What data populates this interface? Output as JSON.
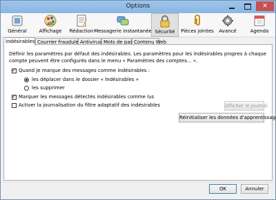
{
  "window": {
    "title": "Options"
  },
  "toolbar": {
    "items": [
      {
        "label": "Général",
        "icon": "general-switch-icon"
      },
      {
        "label": "Affichage",
        "icon": "display-palette-icon"
      },
      {
        "label": "Rédaction",
        "icon": "composition-icon"
      },
      {
        "label": "Messagerie instantanée",
        "icon": "chat-bubbles-icon"
      },
      {
        "label": "Sécurité",
        "icon": "lock-icon"
      },
      {
        "label": "Pièces jointes",
        "icon": "paperclip-icon"
      },
      {
        "label": "Avancé",
        "icon": "gear-icon"
      },
      {
        "label": "Agenda",
        "icon": "calendar-icon"
      }
    ],
    "active": "Sécurité"
  },
  "tabs": [
    "Indésirables",
    "Courrier frauduleux",
    "Antivirus",
    "Mots de passe",
    "Contenu Web"
  ],
  "content": {
    "description": "Définir les paramètres par défaut des indésirables. Les paramètres pour les indésirables propres à chaque compte peuvent être configurés dans le menu « Paramètres des comptes... ».",
    "when_marked": "Quand je marque des messages comme indésirables :",
    "move_option": "les déplacer dans le dossier « Indésirables »",
    "delete_option": "les supprimer",
    "mark_read": "Marquer les messages détectés indésirables comme lus",
    "enable_log": "Activer la journalisation du filtre adaptatif des indésirables",
    "show_log_button": "Afficher le journal",
    "reset_button": "Réinitialiser les données d'apprentissage"
  },
  "footer": {
    "ok": "OK",
    "cancel": "Annuler"
  }
}
